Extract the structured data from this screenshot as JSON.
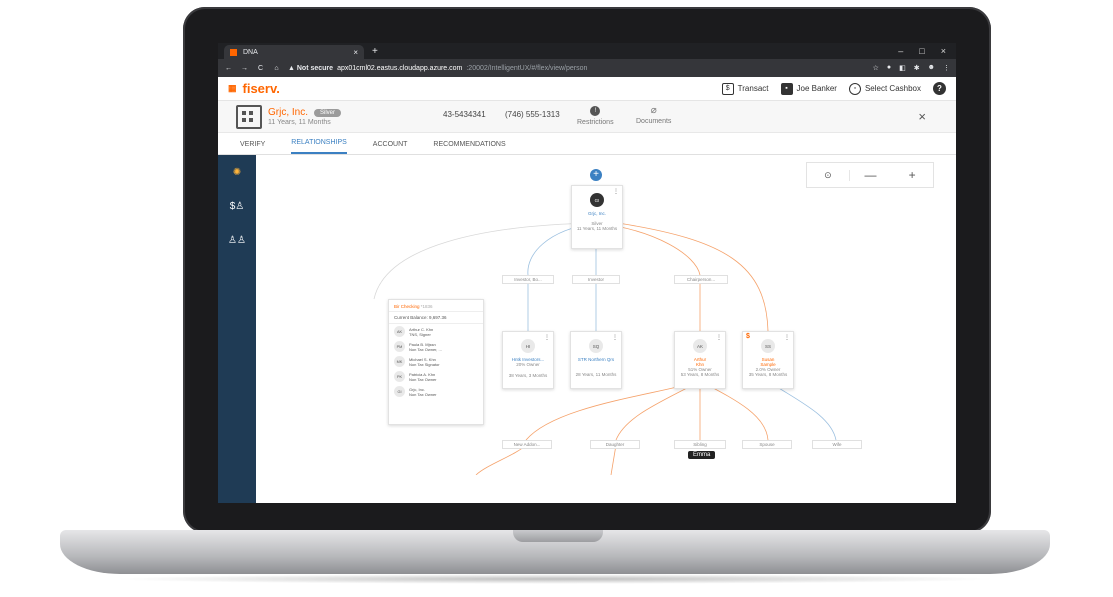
{
  "browser": {
    "tab_title": "DNA",
    "tab_close": "×",
    "new_tab": "+",
    "window_controls": [
      "–",
      "□",
      "×"
    ],
    "nav": [
      "←",
      "→",
      "C",
      "⌂"
    ],
    "security_label": "▲ Not secure",
    "url_host": "apx01cml02.eastus.cloudapp.azure.com",
    "url_path": ":20002/IntelligentUX/#/flex/view/person"
  },
  "app": {
    "brand": "fiserv.",
    "transact_label": "Transact",
    "user_label": "Joe Banker",
    "cashbox_label": "Select Cashbox",
    "help": "?"
  },
  "entity": {
    "name": "Grjc, Inc.",
    "tier_badge": "Silver",
    "tenure": "11 Years, 11 Months",
    "tax_id": "43-5434341",
    "phone": "(746) 555-1313",
    "restrictions_label": "Restrictions",
    "documents_label": "Documents",
    "close": "×"
  },
  "tabs": [
    "VERIFY",
    "RELATIONSHIPS",
    "ACCOUNT",
    "RECOMMENDATIONS"
  ],
  "active_tab": "RELATIONSHIPS",
  "zoom_controls": {
    "center": "⊙",
    "minus": "—",
    "plus": "+"
  },
  "graph": {
    "root": {
      "initials": "GI",
      "name": "Grjc, Inc.",
      "tier": "Silver",
      "tenure": "11 Years, 11 Months"
    },
    "relations_top": [
      "Investor, Bo...",
      "Investor",
      "Chairperson..."
    ],
    "nodes": [
      {
        "initials": "HI",
        "name": "Hntk Investors...",
        "role": "20% Owner",
        "tenure": "38 Years, 3 Months"
      },
      {
        "initials": "SQ",
        "name": "STR Northern Qrs",
        "role": "",
        "tenure": "28 Years, 11 Months"
      },
      {
        "initials": "AK",
        "name": "Arthur",
        "name2": "Khn",
        "role": "51% Owner",
        "tenure": "53 Years, 8 Months"
      },
      {
        "initials": "SS",
        "name": "Susan",
        "name2": "Sample",
        "role": "2.0% Owner",
        "tenure": "35 Years, 8 Months",
        "flag": "$"
      }
    ],
    "relations_bottom": [
      "New Addon...",
      "Daughter",
      "Sibling",
      "Spouse",
      "Wife"
    ],
    "tooltip": "Emma"
  },
  "account": {
    "title": "Bir Checking",
    "number": "*1836",
    "balance": "Current Balance: 9,697.36",
    "signers": [
      {
        "initials": "AK",
        "name": "Arthur C. Khn",
        "role": "TNS, Signer"
      },
      {
        "initials": "PM",
        "name": "Paula B. Mjssn",
        "role": "Non Tax Owner, ..."
      },
      {
        "initials": "MK",
        "name": "Michael S. Khn",
        "role": "Non Tax Signator"
      },
      {
        "initials": "PK",
        "name": "Patricia A. Khn",
        "role": "Non Tax Owner"
      },
      {
        "initials": "GI",
        "name": "Grjc, Inc.",
        "role": "Non Tax Owner"
      }
    ]
  },
  "colors": {
    "brand": "#ff6600",
    "link": "#3b80c2",
    "sidenav": "#1f3b55",
    "line_orange": "#f5a26b",
    "line_blue": "#9cc0e0"
  }
}
